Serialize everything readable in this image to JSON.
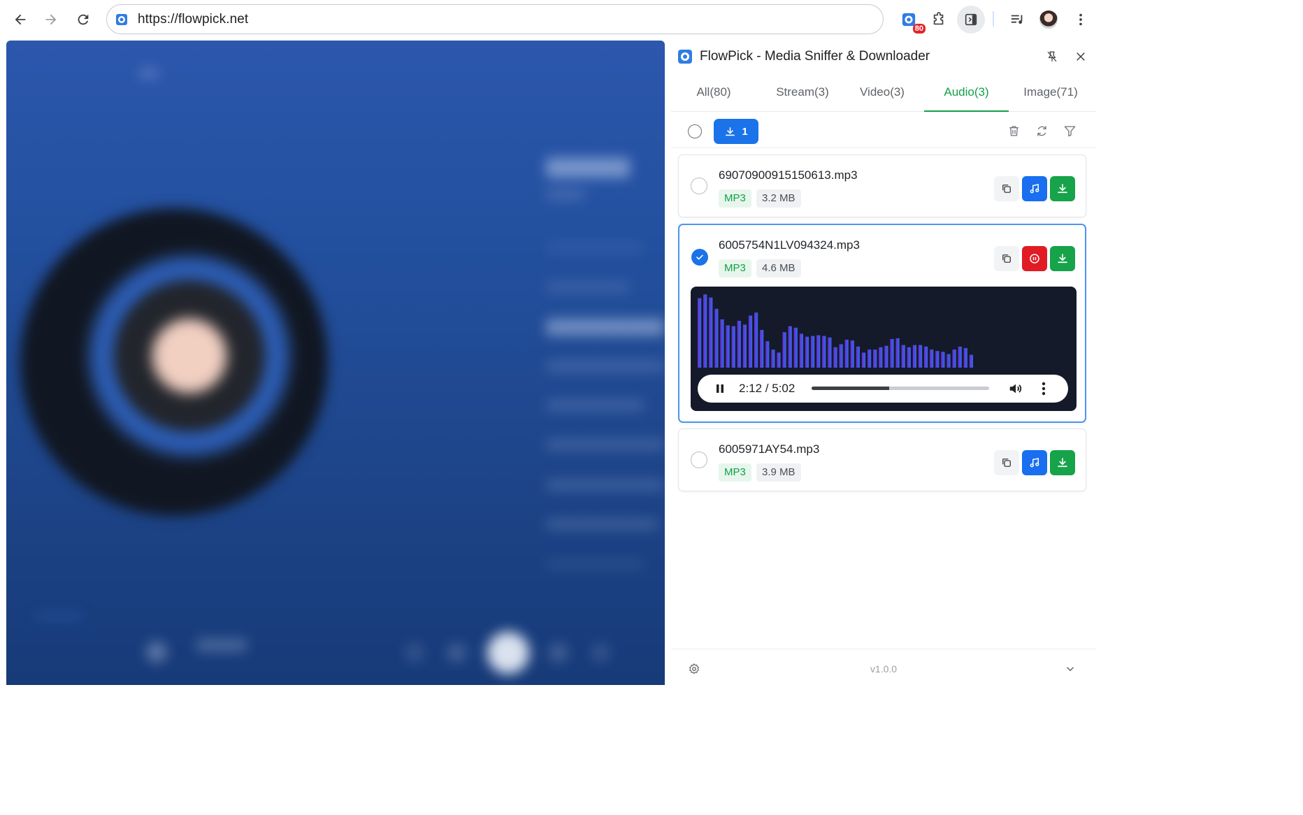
{
  "browser": {
    "url": "https://flowpick.net",
    "extension_badge": "80",
    "icons": [
      "back-icon",
      "forward-icon",
      "reload-icon",
      "site-info-icon",
      "extension-icon",
      "puzzle-icon",
      "side-panel-icon",
      "media-control-icon",
      "profile-avatar",
      "kebab-menu-icon"
    ]
  },
  "panel": {
    "title": "FlowPick - Media Sniffer & Downloader",
    "tabs": [
      {
        "label": "All(80)",
        "active": false
      },
      {
        "label": "Stream(3)",
        "active": false
      },
      {
        "label": "Video(3)",
        "active": false
      },
      {
        "label": "Audio(3)",
        "active": true
      },
      {
        "label": "Image(71)",
        "active": false
      }
    ],
    "download_selected_count": "1",
    "items": [
      {
        "name": "69070900915150613.mp3",
        "format": "MP3",
        "size": "3.2 MB",
        "selected": false,
        "playing": false
      },
      {
        "name": "6005754N1LV094324.mp3",
        "format": "MP3",
        "size": "4.6 MB",
        "selected": true,
        "playing": true
      },
      {
        "name": "6005971AY54.mp3",
        "format": "MP3",
        "size": "3.9 MB",
        "selected": false,
        "playing": false
      }
    ],
    "player": {
      "time": "2:12 / 5:02",
      "progress": 0.437,
      "spectrum": [
        0.92,
        0.97,
        0.93,
        0.78,
        0.64,
        0.56,
        0.55,
        0.62,
        0.57,
        0.69,
        0.73,
        0.5,
        0.35,
        0.24,
        0.2,
        0.47,
        0.55,
        0.53,
        0.45,
        0.41,
        0.42,
        0.43,
        0.42,
        0.4,
        0.27,
        0.31,
        0.37,
        0.36,
        0.28,
        0.2,
        0.24,
        0.24,
        0.27,
        0.29,
        0.38,
        0.39,
        0.3,
        0.27,
        0.3,
        0.3,
        0.28,
        0.24,
        0.22,
        0.21,
        0.18,
        0.24,
        0.28,
        0.26,
        0.17
      ],
      "spectrum_colors": [
        "#6d2bd9",
        "#2d6be6"
      ]
    },
    "version": "v1.0.0"
  },
  "colors": {
    "accent_green": "#14a04a",
    "accent_blue": "#1a73e8",
    "stop_red": "#e01b24"
  }
}
